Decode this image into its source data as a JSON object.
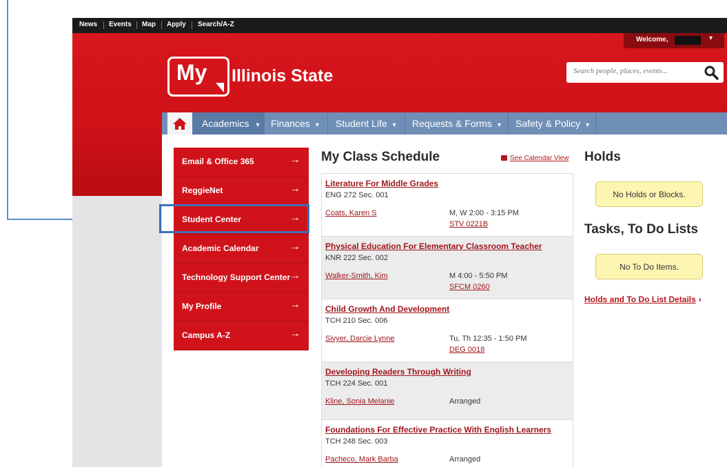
{
  "topbar": {
    "links": [
      "News",
      "Events",
      "Map",
      "Apply",
      "Search/A-Z"
    ]
  },
  "header": {
    "welcome": "Welcome,",
    "logo_text": "My",
    "site_title": "Illinois State",
    "search_placeholder": "Search people, places, events..."
  },
  "nav": {
    "items": [
      "Academics",
      "Finances",
      "Student Life",
      "Requests & Forms",
      "Safety & Policy"
    ],
    "active": "Academics"
  },
  "menu": {
    "items": [
      "Email & Office 365",
      "ReggieNet",
      "Student Center",
      "Academic Calendar",
      "Technology Support Center",
      "My Profile",
      "Campus A-Z"
    ]
  },
  "schedule": {
    "title": "My Class Schedule",
    "calendar_link": "See Calendar View",
    "courses": [
      {
        "title": "Literature For Middle Grades",
        "section": "ENG 272 Sec. 001",
        "instructor": "Coats, Karen S",
        "time": "M, W 2:00 - 3:15 PM",
        "room": "STV 0221B"
      },
      {
        "title": "Physical Education For Elementary Classroom Teacher",
        "section": "KNR 222 Sec. 002",
        "instructor": "Walker-Smith, Kim",
        "time": "M 4:00 - 5:50 PM",
        "room": "SFCM 0260"
      },
      {
        "title": "Child Growth And Development",
        "section": "TCH 210 Sec. 006",
        "instructor": "Sivyer, Darcie Lynne",
        "time": "Tu, Th 12:35 - 1:50 PM",
        "room": "DEG 0018"
      },
      {
        "title": "Developing Readers Through Writing",
        "section": "TCH 224 Sec. 001",
        "instructor": "Kline, Sonia Melanie",
        "time": "Arranged",
        "room": ""
      },
      {
        "title": "Foundations For Effective Practice With English Learners",
        "section": "TCH 248 Sec. 003",
        "instructor": "Pacheco, Mark Barba",
        "time": "Arranged",
        "room": ""
      }
    ]
  },
  "holds": {
    "title": "Holds",
    "message": "No Holds or Blocks."
  },
  "tasks": {
    "title": "Tasks, To Do Lists",
    "message": "No To Do Items.",
    "details_link": "Holds and To Do List Details"
  },
  "colors": {
    "brand_red": "#d0121a",
    "nav_blue": "#6f8fb7",
    "annotation_blue": "#5b8fd0"
  }
}
